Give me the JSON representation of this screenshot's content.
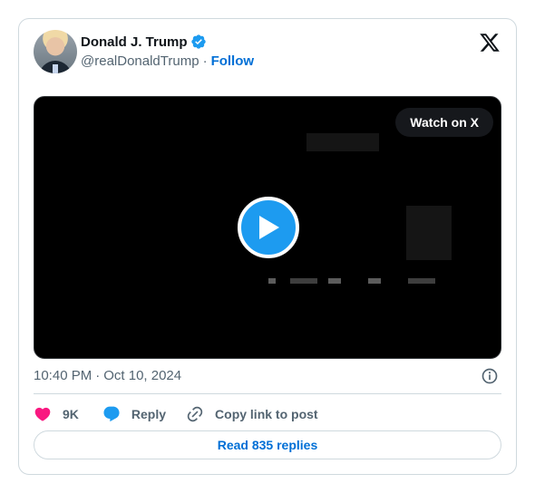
{
  "author": {
    "name": "Donald J. Trump",
    "handle": "@realDonaldTrump",
    "follow_label": "Follow",
    "verified": true
  },
  "colors": {
    "link": "#006fd6",
    "verified": "#1d9bf0",
    "like": "#f91880",
    "play": "#1d9bf0"
  },
  "video": {
    "watch_label": "Watch on X",
    "icon": "play-icon"
  },
  "meta": {
    "time": "10:40 PM",
    "separator": "·",
    "date": "Oct 10, 2024"
  },
  "actions": {
    "like_count": "9K",
    "reply_label": "Reply",
    "copy_label": "Copy link to post"
  },
  "footer": {
    "read_replies_label": "Read 835 replies"
  },
  "icons": [
    "verified-badge-icon",
    "x-logo-icon",
    "play-icon",
    "info-icon",
    "heart-icon",
    "reply-bubble-icon",
    "link-icon"
  ]
}
